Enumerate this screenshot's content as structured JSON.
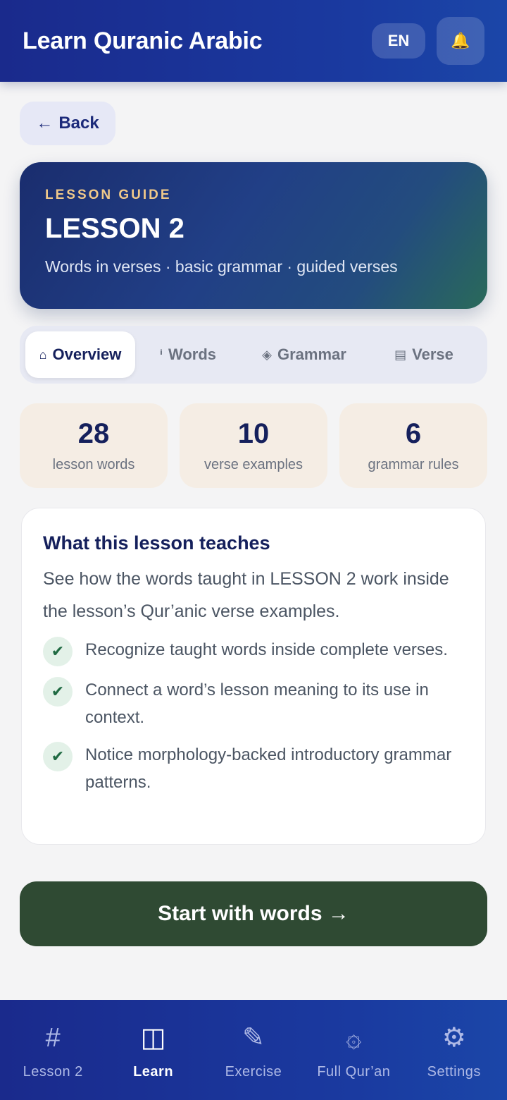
{
  "header": {
    "title": "Learn Quranic Arabic",
    "language_label": "EN",
    "notification_icon": "bell-icon"
  },
  "back": {
    "arrow": "←",
    "label": "Back"
  },
  "hero": {
    "kicker": "LESSON GUIDE",
    "title": "LESSON 2",
    "subtitle": "Words in verses · basic grammar · guided verses"
  },
  "tabs": [
    {
      "icon": "⌂",
      "label": "Overview",
      "active": true
    },
    {
      "icon": "ⁱ",
      "label": "Words",
      "active": false
    },
    {
      "icon": "◈",
      "label": "Grammar",
      "active": false
    },
    {
      "icon": "▤",
      "label": "Verse",
      "active": false
    }
  ],
  "stats": [
    {
      "value": "28",
      "label": "lesson words"
    },
    {
      "value": "10",
      "label": "verse examples"
    },
    {
      "value": "6",
      "label": "grammar rules"
    }
  ],
  "teach": {
    "title": "What this lesson teaches",
    "description": "See how the words taught in LESSON 2 work inside the lesson’s Qur’anic verse examples.",
    "points": [
      "Recognize taught words inside complete verses.",
      "Connect a word’s lesson meaning to its use in context.",
      "Notice morphology-backed introductory grammar patterns."
    ],
    "check_glyph": "✔"
  },
  "cta": {
    "label": "Start with words →"
  },
  "bottom_nav": [
    {
      "icon": "#",
      "label": "Lesson 2",
      "active": false
    },
    {
      "icon": "◫",
      "label": "Learn",
      "active": true
    },
    {
      "icon": "✎",
      "label": "Exercise",
      "active": false
    },
    {
      "icon": "۞",
      "label": "Full Qur’an",
      "active": false
    },
    {
      "icon": "⚙",
      "label": "Settings",
      "active": false
    }
  ],
  "colors": {
    "brand_blue": "#1a2a8c",
    "accent_gold": "#f0c98a",
    "cta_green": "#2f4a33",
    "stat_bg": "#f5ede4",
    "check_green": "#1f6a42"
  }
}
